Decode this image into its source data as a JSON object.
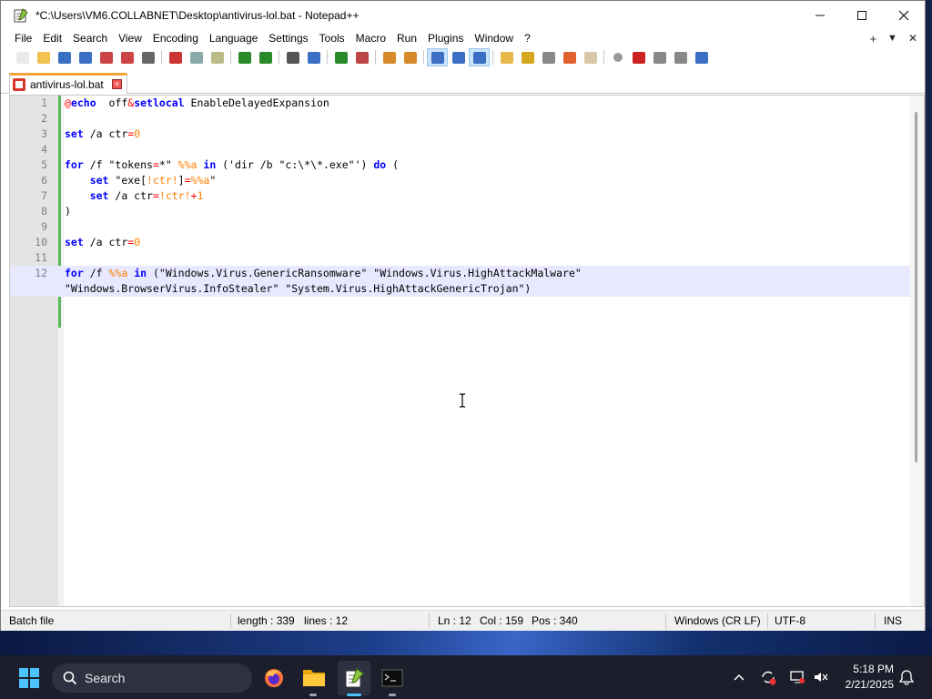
{
  "window": {
    "title": "*C:\\Users\\VM6.COLLABNET\\Desktop\\antivirus-lol.bat - Notepad++"
  },
  "menu": [
    "File",
    "Edit",
    "Search",
    "View",
    "Encoding",
    "Language",
    "Settings",
    "Tools",
    "Macro",
    "Run",
    "Plugins",
    "Window",
    "?"
  ],
  "menu_right": {
    "plus": "+",
    "down": "▼",
    "close": "✕"
  },
  "toolbar_icons": [
    "new-file-icon",
    "open-file-icon",
    "save-icon",
    "save-all-icon",
    "close-icon",
    "close-all-icon",
    "print-icon",
    "cut-icon",
    "copy-icon",
    "paste-icon",
    "undo-icon",
    "redo-icon",
    "find-icon",
    "replace-icon",
    "zoom-in-icon",
    "zoom-out-icon",
    "sync-vertical-icon",
    "sync-horizontal-icon",
    "word-wrap-icon",
    "show-all-characters-icon",
    "indent-guide-icon",
    "user-defined-language-icon",
    "document-map-icon",
    "function-list-icon",
    "folder-as-workspace-icon",
    "monitoring-icon",
    "record-macro-icon",
    "stop-macro-icon",
    "play-macro-icon",
    "run-macro-multiple-icon",
    "save-macro-icon"
  ],
  "tab": {
    "label": "antivirus-lol.bat"
  },
  "editor": {
    "lines": [
      {
        "n": "1",
        "segs": [
          [
            "at",
            "@"
          ],
          [
            "kw",
            "echo"
          ],
          [
            "",
            "  off"
          ],
          [
            "op",
            "&"
          ],
          [
            "kw",
            "setlocal"
          ],
          [
            "",
            " EnableDelayedExpansion"
          ]
        ]
      },
      {
        "n": "2",
        "segs": []
      },
      {
        "n": "3",
        "segs": [
          [
            "kw",
            "set"
          ],
          [
            "",
            " /a ctr"
          ],
          [
            "op",
            "="
          ],
          [
            "num",
            "0"
          ]
        ]
      },
      {
        "n": "4",
        "segs": []
      },
      {
        "n": "5",
        "segs": [
          [
            "kw",
            "for"
          ],
          [
            "",
            " /f \"tokens"
          ],
          [
            "op",
            "="
          ],
          [
            "",
            "*\" "
          ],
          [
            "var",
            "%%a"
          ],
          [
            "",
            " "
          ],
          [
            "kw",
            "in"
          ],
          [
            "",
            " ('dir /b \"c:\\*\\*.exe\"') "
          ],
          [
            "kw",
            "do"
          ],
          [
            "",
            " ("
          ]
        ]
      },
      {
        "n": "6",
        "segs": [
          [
            "",
            "    "
          ],
          [
            "kw",
            "set"
          ],
          [
            "",
            " \"exe["
          ],
          [
            "var",
            "!ctr!"
          ],
          [
            "",
            "]"
          ],
          [
            "op",
            "="
          ],
          [
            "var",
            "%%a"
          ],
          [
            "",
            "\""
          ]
        ]
      },
      {
        "n": "7",
        "segs": [
          [
            "",
            "    "
          ],
          [
            "kw",
            "set"
          ],
          [
            "",
            " /a ctr"
          ],
          [
            "op",
            "="
          ],
          [
            "var",
            "!ctr!"
          ],
          [
            "op",
            "+"
          ],
          [
            "num",
            "1"
          ]
        ]
      },
      {
        "n": "8",
        "segs": [
          [
            "",
            ")"
          ]
        ]
      },
      {
        "n": "9",
        "segs": []
      },
      {
        "n": "10",
        "segs": [
          [
            "kw",
            "set"
          ],
          [
            "",
            " /a ctr"
          ],
          [
            "op",
            "="
          ],
          [
            "num",
            "0"
          ]
        ]
      },
      {
        "n": "11",
        "segs": []
      },
      {
        "n": "12",
        "segs": [
          [
            "kw",
            "for"
          ],
          [
            "",
            " /f "
          ],
          [
            "var",
            "%%a"
          ],
          [
            "",
            " "
          ],
          [
            "kw",
            "in"
          ],
          [
            "",
            " (\"Windows.Virus.GenericRansomware\" \"Windows.Virus.HighAttackMalware\""
          ]
        ]
      },
      {
        "n": "",
        "segs": [
          [
            "",
            "\"Windows.BrowserVirus.InfoStealer\" \"System.Virus.HighAttackGenericTrojan\")"
          ]
        ]
      }
    ]
  },
  "status": {
    "type": "Batch file",
    "length": "length : 339",
    "lines": "lines : 12",
    "ln": "Ln : 12",
    "col": "Col : 159",
    "pos": "Pos : 340",
    "eol": "Windows (CR LF)",
    "encoding": "UTF-8",
    "mode": "INS"
  },
  "taskbar": {
    "search_label": "Search",
    "time": "5:18 PM",
    "date": "2/21/2025"
  }
}
